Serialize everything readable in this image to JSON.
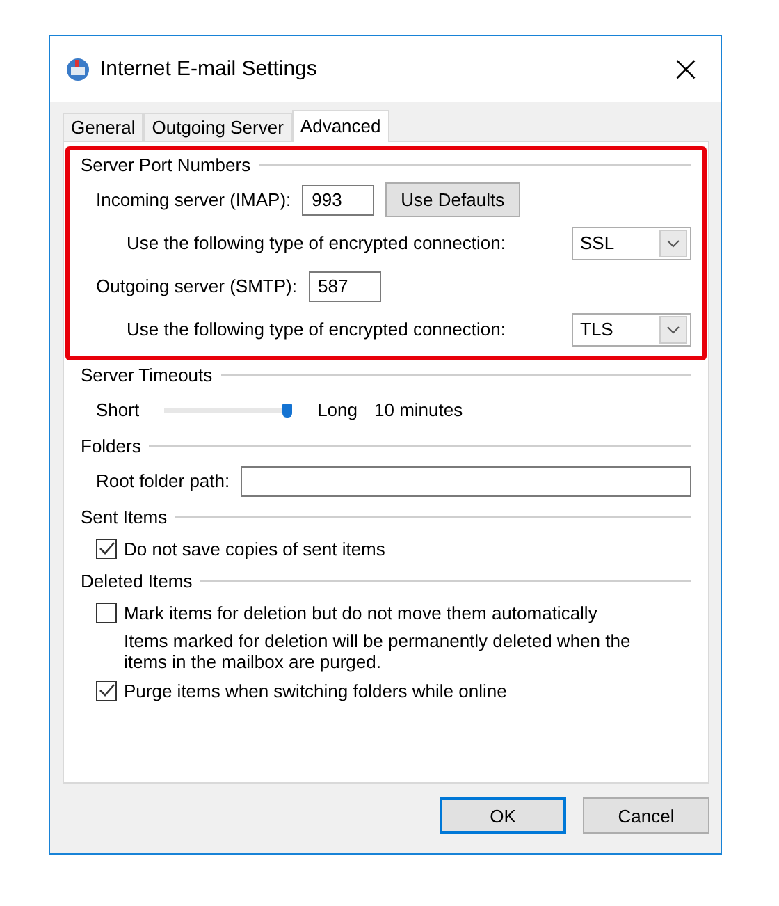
{
  "window": {
    "title": "Internet E-mail Settings",
    "close": "×"
  },
  "tabs": [
    {
      "label": "General",
      "selected": false
    },
    {
      "label": "Outgoing Server",
      "selected": false
    },
    {
      "label": "Advanced",
      "selected": true
    }
  ],
  "server_port_numbers": {
    "heading": "Server Port Numbers",
    "highlighted": true,
    "incoming": {
      "label": "Incoming server (IMAP):",
      "value": "993",
      "button": "Use Defaults",
      "encryption_label": "Use the following type of encrypted connection:",
      "encryption": "SSL"
    },
    "outgoing": {
      "label": "Outgoing server (SMTP):",
      "value": "587",
      "encryption_label": "Use the following type of encrypted connection:",
      "encryption": "TLS"
    }
  },
  "server_timeouts": {
    "heading": "Server Timeouts",
    "min_label": "Short",
    "max_label": "Long",
    "level": 1,
    "reading": "10 minutes"
  },
  "folders": {
    "heading": "Folders",
    "root_folder_label": "Root folder path:"
  },
  "sent_items": {
    "heading": "Sent Items",
    "options": [
      {
        "label": "Do not save copies of sent items",
        "checked": true
      }
    ]
  },
  "deleted_items": {
    "heading": "Deleted Items",
    "options": [
      {
        "label": "Mark items for deletion but do not move them automatically",
        "checked": false,
        "note": "Items marked for deletion will be permanently deleted when the items in the mailbox are purged."
      },
      {
        "label": "Purge items when switching folders while online",
        "checked": true
      }
    ]
  },
  "buttons": [
    {
      "label": "OK",
      "default": true
    },
    {
      "label": "Cancel",
      "default": false
    }
  ]
}
